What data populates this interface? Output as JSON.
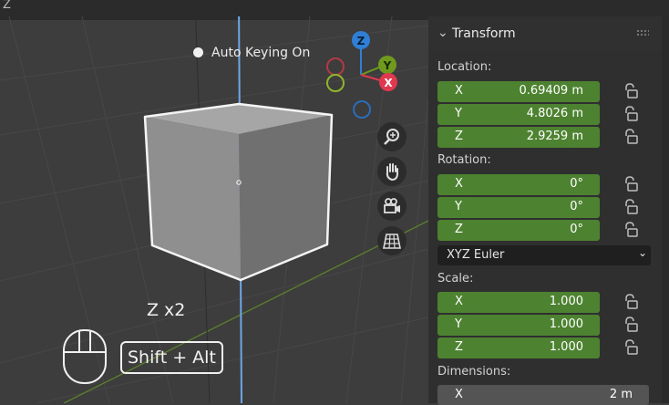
{
  "topbar": {
    "text": "Z"
  },
  "viewport": {
    "auto_keying": "Auto Keying On",
    "gizmo": {
      "z": "Z",
      "y": "Y",
      "x": "X"
    },
    "key_hint": "Z x2",
    "modifier_keys": "Shift + Alt",
    "nav_icons": [
      "zoom-icon",
      "hand-pan-icon",
      "camera-icon",
      "grid-icon"
    ]
  },
  "panel": {
    "title": "Transform",
    "location": {
      "label": "Location:",
      "fields": [
        {
          "axis": "X",
          "value": "0.69409 m"
        },
        {
          "axis": "Y",
          "value": "4.8026 m"
        },
        {
          "axis": "Z",
          "value": "2.9259 m"
        }
      ]
    },
    "rotation": {
      "label": "Rotation:",
      "fields": [
        {
          "axis": "X",
          "value": "0°"
        },
        {
          "axis": "Y",
          "value": "0°"
        },
        {
          "axis": "Z",
          "value": "0°"
        }
      ],
      "mode": "XYZ Euler"
    },
    "scale": {
      "label": "Scale:",
      "fields": [
        {
          "axis": "X",
          "value": "1.000"
        },
        {
          "axis": "Y",
          "value": "1.000"
        },
        {
          "axis": "Z",
          "value": "1.000"
        }
      ]
    },
    "dimensions": {
      "label": "Dimensions:",
      "fields": [
        {
          "axis": "X",
          "value": "2 m"
        }
      ]
    }
  },
  "colors": {
    "field_green": "#4d8330",
    "gizmo_z": "#2f7fd6",
    "gizmo_y": "#6f9a1e",
    "gizmo_x": "#e0384f",
    "viewport_bg": "#3d3d3d"
  }
}
